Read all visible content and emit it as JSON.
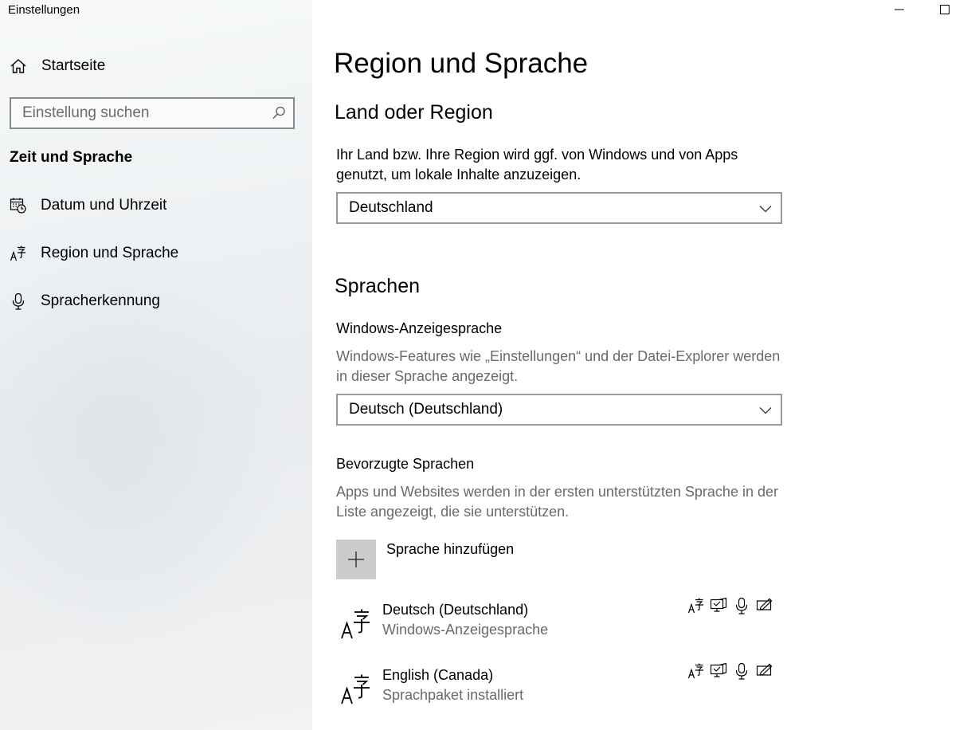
{
  "window": {
    "title": "Einstellungen"
  },
  "sidebar": {
    "home_label": "Startseite",
    "search_placeholder": "Einstellung suchen",
    "section_title": "Zeit und Sprache",
    "items": [
      {
        "label": "Datum und Uhrzeit",
        "icon": "calendar-clock-icon"
      },
      {
        "label": "Region und Sprache",
        "icon": "language-icon"
      },
      {
        "label": "Spracherkennung",
        "icon": "microphone-icon"
      }
    ]
  },
  "main": {
    "title": "Region und Sprache",
    "region": {
      "heading": "Land oder Region",
      "description": "Ihr Land bzw. Ihre Region wird ggf. von Windows und von Apps genutzt, um lokale Inhalte anzuzeigen.",
      "selected": "Deutschland"
    },
    "languages": {
      "heading": "Sprachen",
      "display_language": {
        "label": "Windows-Anzeigesprache",
        "description": "Windows-Features wie „Einstellungen“ und der Datei-Explorer werden in dieser Sprache angezeigt.",
        "selected": "Deutsch (Deutschland)"
      },
      "preferred": {
        "label": "Bevorzugte Sprachen",
        "description": "Apps und Websites werden in der ersten unterstützten Sprache in der Liste angezeigt, die sie unterstützen.",
        "add_label": "Sprache hinzufügen",
        "list": [
          {
            "name": "Deutsch (Deutschland)",
            "status": "Windows-Anzeigesprache",
            "features": [
              "language-pack-icon",
              "display-icon",
              "microphone-icon",
              "handwriting-icon"
            ]
          },
          {
            "name": "English (Canada)",
            "status": "Sprachpaket installiert",
            "features": [
              "language-pack-icon",
              "display-icon",
              "microphone-icon",
              "handwriting-icon"
            ]
          }
        ]
      }
    }
  },
  "colors": {
    "sidebar_bg": "#eef1f3",
    "main_bg": "#ffffff",
    "muted_text": "#6a6a6a",
    "add_button_bg": "#cccccc",
    "dropdown_border": "#999999"
  }
}
